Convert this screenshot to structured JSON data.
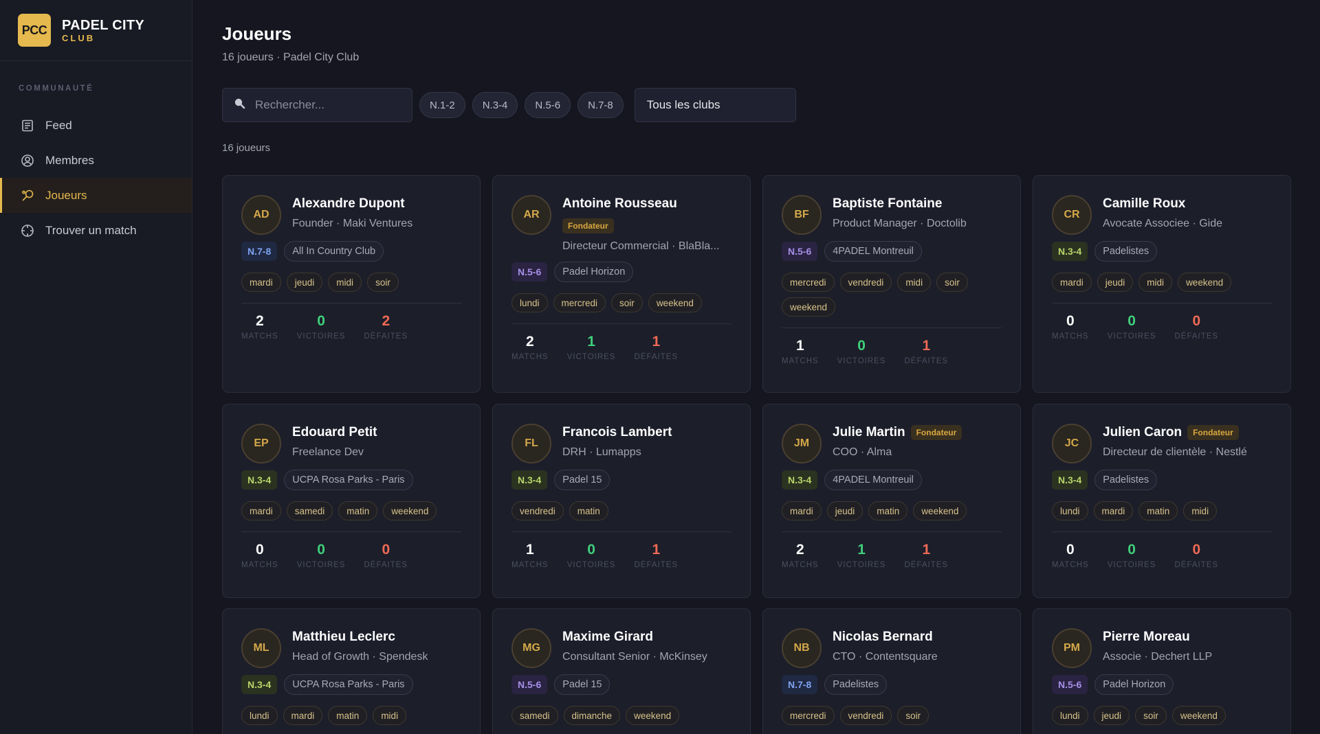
{
  "brand": {
    "logo": "PCC",
    "name": "PADEL CITY",
    "sub": "CLUB"
  },
  "sidebar": {
    "section": "COMMUNAUTÉ",
    "items": [
      {
        "label": "Feed",
        "icon": "newspaper-icon"
      },
      {
        "label": "Membres",
        "icon": "user-circle-icon"
      },
      {
        "label": "Joueurs",
        "icon": "padel-racket-icon",
        "active": true
      },
      {
        "label": "Trouver un match",
        "icon": "crosshair-icon"
      }
    ]
  },
  "header": {
    "title": "Joueurs",
    "subtitle": "16 joueurs · Padel City Club"
  },
  "filters": {
    "search_placeholder": "Rechercher...",
    "levels": [
      "N.1-2",
      "N.3-4",
      "N.5-6",
      "N.7-8"
    ],
    "club": "Tous les clubs"
  },
  "result_count": "16 joueurs",
  "stat_labels": {
    "matches": "MATCHS",
    "wins": "VICTOIRES",
    "losses": "DÉFAITES"
  },
  "founder_label": "Fondateur",
  "players": [
    {
      "initials": "AD",
      "name": "Alexandre Dupont",
      "role": "Founder · Maki Ventures",
      "level": "N.7-8",
      "club": "All In Country Club",
      "tags": [
        "mardi",
        "jeudi",
        "midi",
        "soir"
      ],
      "matches": "2",
      "wins": "0",
      "losses": "2"
    },
    {
      "initials": "AR",
      "name": "Antoine Rousseau",
      "founder": "block",
      "role": "Directeur Commercial · BlaBla...",
      "level": "N.5-6",
      "club": "Padel Horizon",
      "tags": [
        "lundi",
        "mercredi",
        "soir",
        "weekend"
      ],
      "matches": "2",
      "wins": "1",
      "losses": "1"
    },
    {
      "initials": "BF",
      "name": "Baptiste Fontaine",
      "role": "Product Manager · Doctolib",
      "level": "N.5-6",
      "club": "4PADEL Montreuil",
      "tags": [
        "mercredi",
        "vendredi",
        "midi",
        "soir",
        "weekend"
      ],
      "matches": "1",
      "wins": "0",
      "losses": "1"
    },
    {
      "initials": "CR",
      "name": "Camille Roux",
      "role": "Avocate Associee · Gide",
      "level": "N.3-4",
      "club": "Padelistes",
      "tags": [
        "mardi",
        "jeudi",
        "midi",
        "weekend"
      ],
      "matches": "0",
      "wins": "0",
      "losses": "0"
    },
    {
      "initials": "EP",
      "name": "Edouard Petit",
      "role": "Freelance Dev",
      "level": "N.3-4",
      "club": "UCPA Rosa Parks - Paris",
      "tags": [
        "mardi",
        "samedi",
        "matin",
        "weekend"
      ],
      "matches": "0",
      "wins": "0",
      "losses": "0"
    },
    {
      "initials": "FL",
      "name": "Francois Lambert",
      "role": "DRH · Lumapps",
      "level": "N.3-4",
      "club": "Padel 15",
      "tags": [
        "vendredi",
        "matin"
      ],
      "matches": "1",
      "wins": "0",
      "losses": "1"
    },
    {
      "initials": "JM",
      "name": "Julie Martin",
      "founder": "inline",
      "role": "COO · Alma",
      "level": "N.3-4",
      "club": "4PADEL Montreuil",
      "tags": [
        "mardi",
        "jeudi",
        "matin",
        "weekend"
      ],
      "matches": "2",
      "wins": "1",
      "losses": "1"
    },
    {
      "initials": "JC",
      "name": "Julien Caron",
      "founder": "inline",
      "role": "Directeur de clientèle · Nestlé",
      "level": "N.3-4",
      "club": "Padelistes",
      "tags": [
        "lundi",
        "mardi",
        "matin",
        "midi"
      ],
      "matches": "0",
      "wins": "0",
      "losses": "0"
    },
    {
      "initials": "ML",
      "name": "Matthieu Leclerc",
      "role": "Head of Growth · Spendesk",
      "level": "N.3-4",
      "club": "UCPA Rosa Parks - Paris",
      "tags": [
        "lundi",
        "mardi",
        "matin",
        "midi"
      ]
    },
    {
      "initials": "MG",
      "name": "Maxime Girard",
      "role": "Consultant Senior · McKinsey",
      "level": "N.5-6",
      "club": "Padel 15",
      "tags": [
        "samedi",
        "dimanche",
        "weekend"
      ]
    },
    {
      "initials": "NB",
      "name": "Nicolas Bernard",
      "role": "CTO · Contentsquare",
      "level": "N.7-8",
      "club": "Padelistes",
      "tags": [
        "mercredi",
        "vendredi",
        "soir"
      ]
    },
    {
      "initials": "PM",
      "name": "Pierre Moreau",
      "role": "Associe · Dechert LLP",
      "level": "N.5-6",
      "club": "Padel Horizon",
      "tags": [
        "lundi",
        "jeudi",
        "soir",
        "weekend"
      ]
    }
  ]
}
